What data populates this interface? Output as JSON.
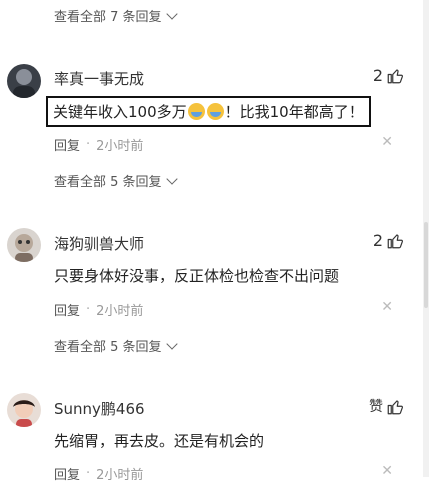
{
  "top_view_all": "查看全部 7 条回复",
  "comments": [
    {
      "username": "率真一事无成",
      "likes": "2",
      "text_before": "关键年收入100多万",
      "text_after": "！比我10年都高了！",
      "reply_label": "回复",
      "time": "2小时前",
      "view_all": "查看全部 5 条回复"
    },
    {
      "username": "海狗驯兽大师",
      "likes": "2",
      "text": "只要身体好没事，反正体检也检查不出问题",
      "reply_label": "回复",
      "time": "2小时前",
      "view_all": "查看全部 5 条回复"
    },
    {
      "username": "Sunny鹏466",
      "likes": "赞",
      "text": "先缩胃，再去皮。还是有机会的",
      "reply_label": "回复",
      "time": "2小时前"
    }
  ],
  "icons": {
    "like": "thumbs-up-icon",
    "close": "close-icon",
    "chevron": "chevron-down-icon",
    "emoji": "crying-laughing-emoji-icon"
  }
}
